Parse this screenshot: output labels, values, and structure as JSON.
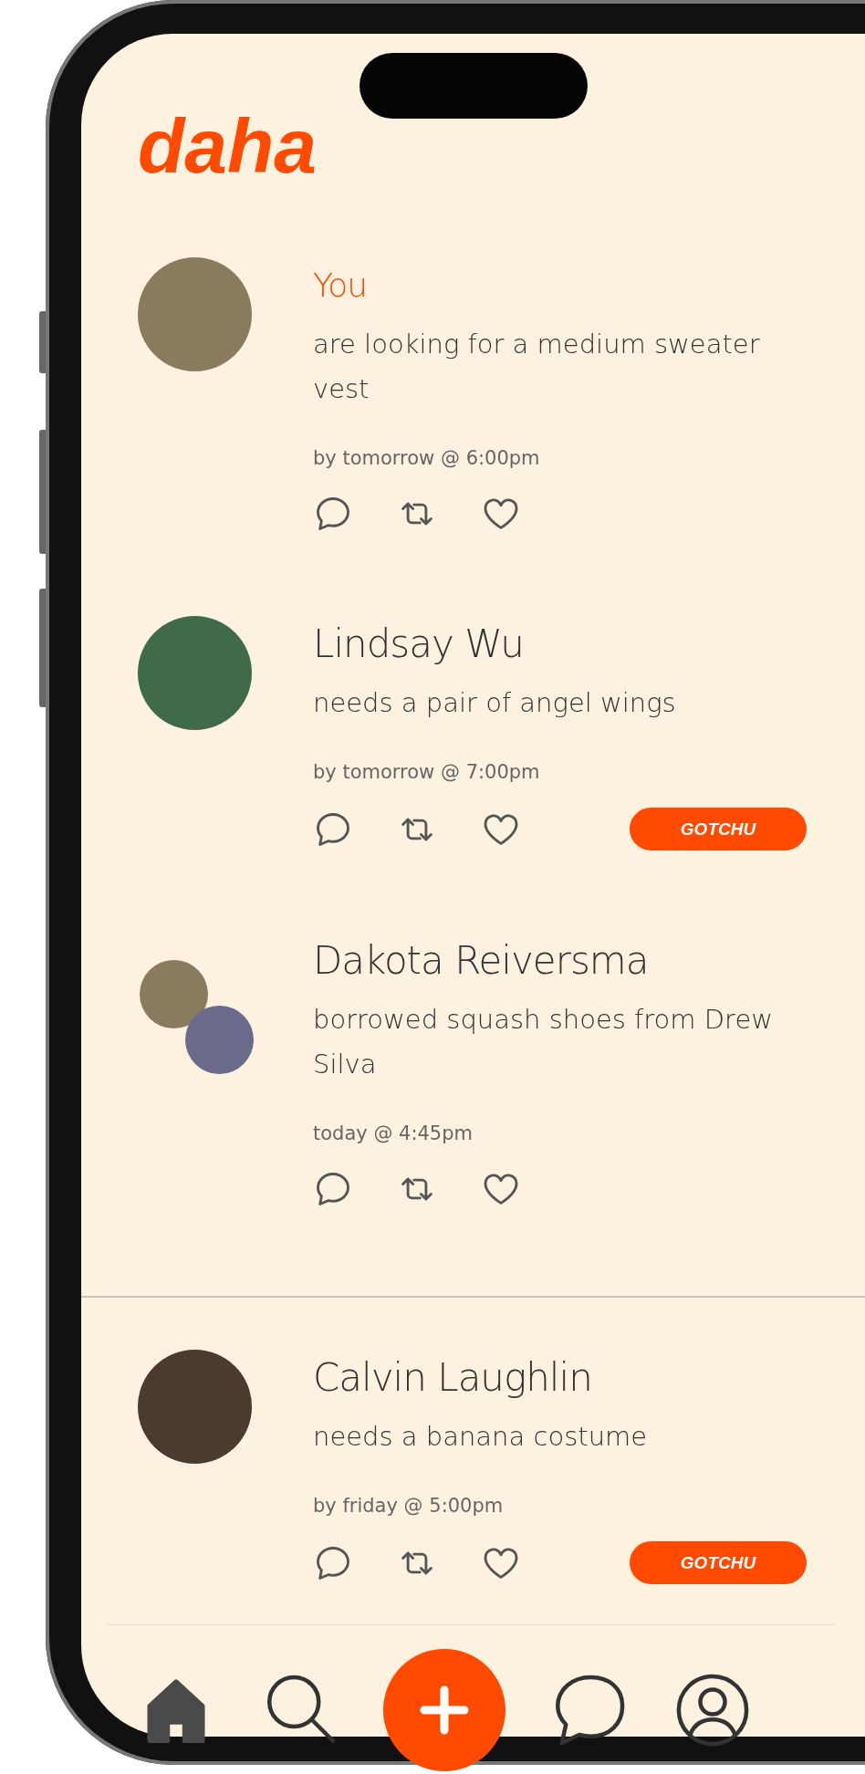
{
  "app": {
    "logo": "daha"
  },
  "posts": [
    {
      "kind": "single",
      "is_self": true,
      "name": "You",
      "text": "are looking for a medium sweater vest",
      "time": "by tomorrow @ 6:00pm",
      "divider_after": false
    },
    {
      "kind": "single",
      "is_self": false,
      "name": "Lindsay Wu",
      "text": "needs a pair of angel wings",
      "time": "by tomorrow @ 7:00pm",
      "action": "GOTCHU",
      "divider_after": false
    },
    {
      "kind": "exchange",
      "is_self": false,
      "name": "Dakota Reiversma",
      "text": "borrowed squash shoes from Drew Silva",
      "time": "today @ 4:45pm",
      "divider_after": true
    },
    {
      "kind": "single",
      "is_self": false,
      "name": "Calvin Laughlin",
      "text": "needs a banana costume",
      "time": "by friday @ 5:00pm",
      "action": "GOTCHU",
      "divider_after": false
    }
  ],
  "nav": [
    {
      "kind": "home",
      "selected": true
    },
    {
      "kind": "search",
      "selected": false
    },
    {
      "kind": "create",
      "selected": false
    },
    {
      "kind": "chat",
      "selected": false
    },
    {
      "kind": "profile",
      "selected": false
    }
  ]
}
